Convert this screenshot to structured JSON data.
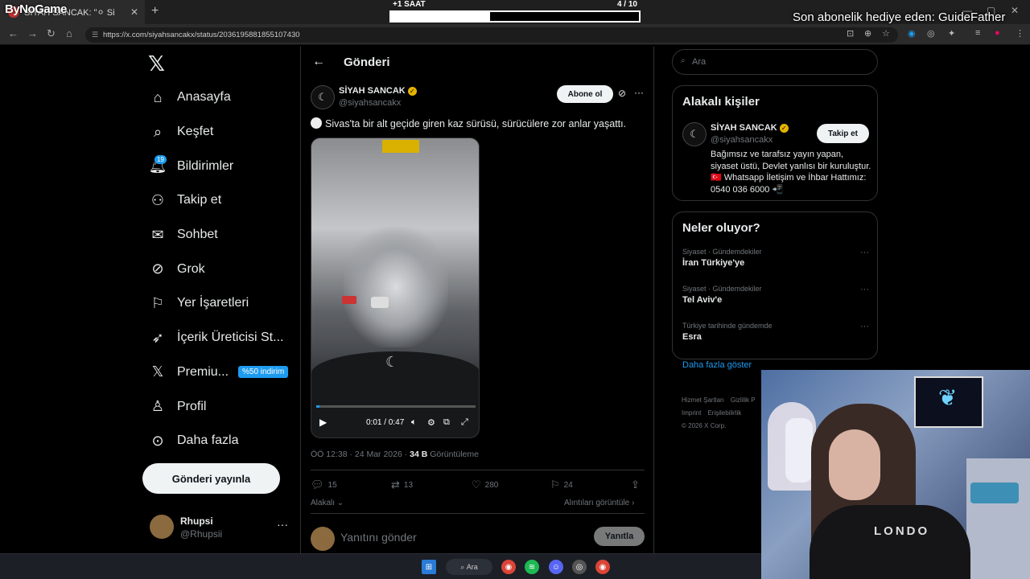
{
  "browser": {
    "tab_title": "SİYAH SANCAK: \"⚪ Si",
    "url": "https://x.com/siyahsancakx/status/2036195881855107430",
    "new_tab_icon": "plus-icon"
  },
  "overlays": {
    "logo": "ByNoGame",
    "timer_label": "+1 SAAT",
    "timer_count": "4  / 10",
    "timer_progress": 0.4,
    "sub_gift": "Son abonelik hediye eden: GuideFather"
  },
  "nav": {
    "items": [
      {
        "label": "Anasayfa",
        "icon": "home-icon"
      },
      {
        "label": "Keşfet",
        "icon": "search-icon"
      },
      {
        "label": "Bildirimler",
        "icon": "bell-icon",
        "badge": "19"
      },
      {
        "label": "Takip et",
        "icon": "follow-icon"
      },
      {
        "label": "Sohbet",
        "icon": "mail-icon"
      },
      {
        "label": "Grok",
        "icon": "grok-icon"
      },
      {
        "label": "Yer İşaretleri",
        "icon": "bookmark-icon"
      },
      {
        "label": "İçerik Üreticisi St...",
        "icon": "rocket-icon"
      },
      {
        "label": "Premiu...",
        "icon": "x-icon",
        "pill": "%50 indirim"
      },
      {
        "label": "Profil",
        "icon": "person-icon"
      },
      {
        "label": "Daha fazla",
        "icon": "more-icon"
      }
    ],
    "post_button": "Gönderi yayınla",
    "account_name": "Rhupsi",
    "account_handle": "@Rhupsii"
  },
  "post": {
    "header_title": "Gönderi",
    "author_name": "SİYAH SANCAK",
    "author_handle": "@siyahsancakx",
    "subscribe_label": "Abone ol",
    "text": "Sivas'ta bir alt geçide giren kaz sürüsü, sürücülere zor anlar yaşattı.",
    "video_time": "0:01 / 0:47",
    "video_progress": 0.021,
    "timestamp": "ÖÖ 12:38 · 24 Mar 2026 · ",
    "views_count": "34 B",
    "views_label": "Görüntüleme",
    "replies": "15",
    "reposts": "13",
    "likes": "280",
    "bookmarks": "24",
    "relevant_label": "Alakalı",
    "quotes_label": "Alıntıları görüntüle",
    "reply_placeholder": "Yanıtını gönder",
    "reply_button": "Yanıtla"
  },
  "sidebar": {
    "search_placeholder": "Ara",
    "relevant_title": "Alakalı kişiler",
    "person_name": "SİYAH SANCAK",
    "person_handle": "@siyahsancakx",
    "follow_label": "Takip et",
    "person_bio": "Bağımsız ve tarafsız yayın yapan, siyaset üstü, Devlet yanlısı bir kuruluştur. 🇹🇷 Whatsapp İletişim ve İhbar Hattımız: 0540 036 6000 📲",
    "trends_title": "Neler oluyor?",
    "trends": [
      {
        "context": "Siyaset · Gündemdekiler",
        "title": "İran Türkiye'ye"
      },
      {
        "context": "Siyaset · Gündemdekiler",
        "title": "Tel Aviv'e"
      },
      {
        "context": "Türkiye tarihinde gündemde",
        "title": "Esra"
      }
    ],
    "show_more": "Daha fazla göster",
    "footer": [
      "Hizmet Şartları",
      "Gizlilik P",
      "Imprint",
      "Erişilebilirlik",
      "© 2026 X Corp."
    ]
  },
  "webcam": {
    "shirt_text": "LONDO"
  },
  "taskbar": {
    "search_label": "Ara"
  }
}
